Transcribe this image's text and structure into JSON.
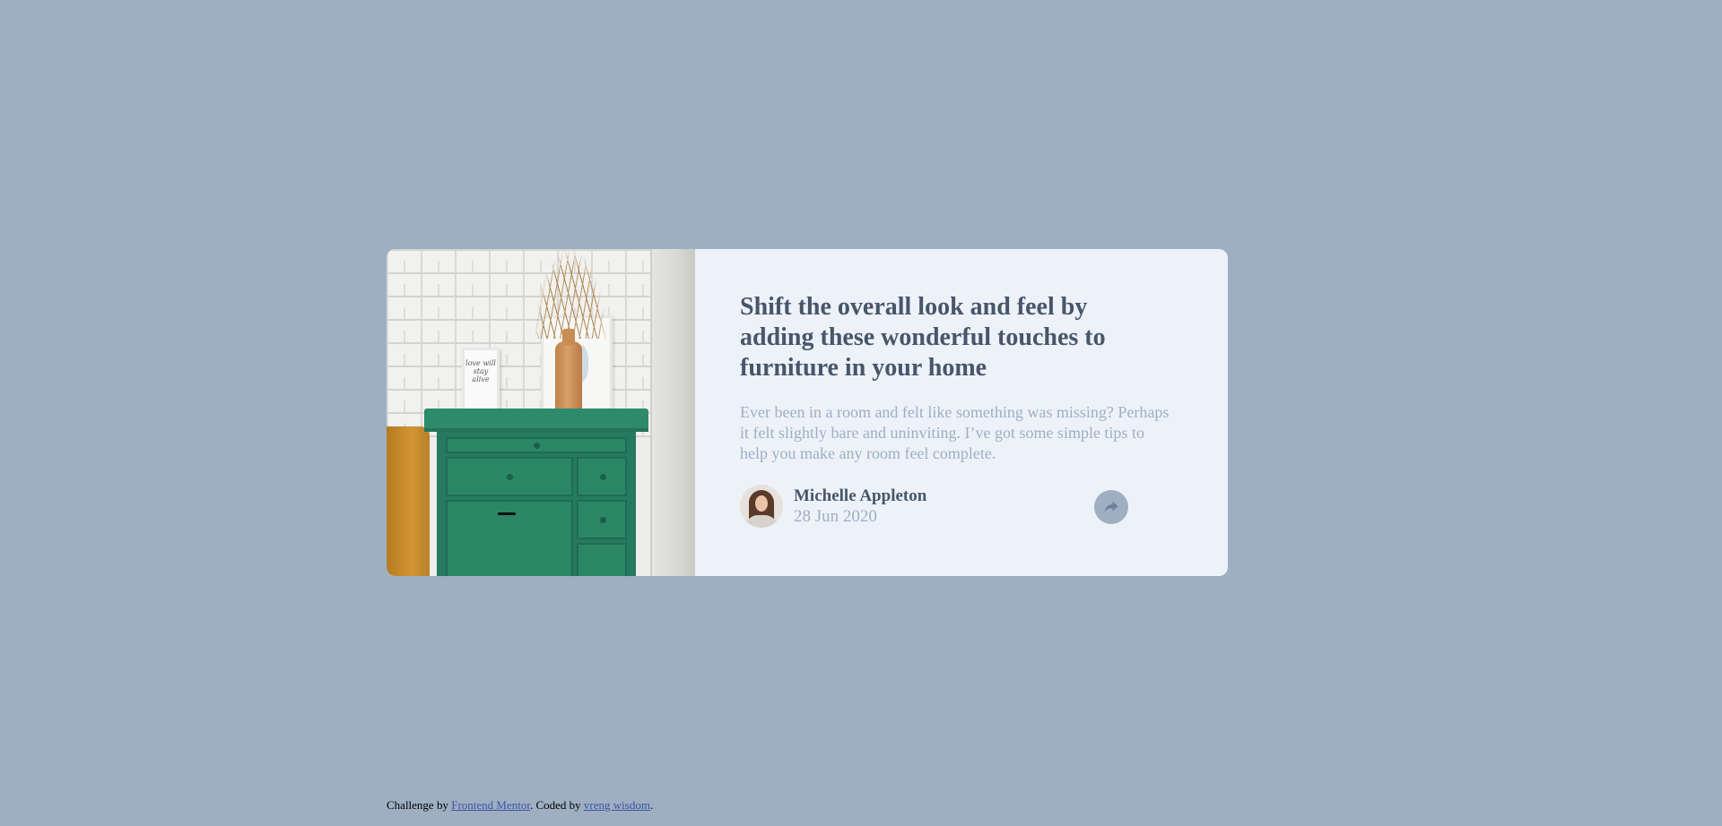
{
  "article": {
    "title": "Shift the overall look and feel by adding these wonderful touches to furniture in your home",
    "excerpt": "Ever been in a room and felt like something was missing? Perhaps it felt slightly bare and uninviting. I’ve got some simple tips to help you make any room feel complete.",
    "image_frame_text": "love will stay alive",
    "author": {
      "name": "Michelle Appleton",
      "date": "28 Jun 2020",
      "avatar": "avatar-photo"
    },
    "share_icon": "share-arrow-icon"
  },
  "footer": {
    "prefix": "Challenge by ",
    "link1": "Frontend Mentor",
    "middle": ". Coded by ",
    "link2": "vreng wisdom",
    "suffix": "."
  },
  "colors": {
    "page_background": "#9eafc2",
    "card_background": "#ecf2f8",
    "heading": "#48556a",
    "muted": "#9eafc2",
    "link": "#3e52a3"
  }
}
